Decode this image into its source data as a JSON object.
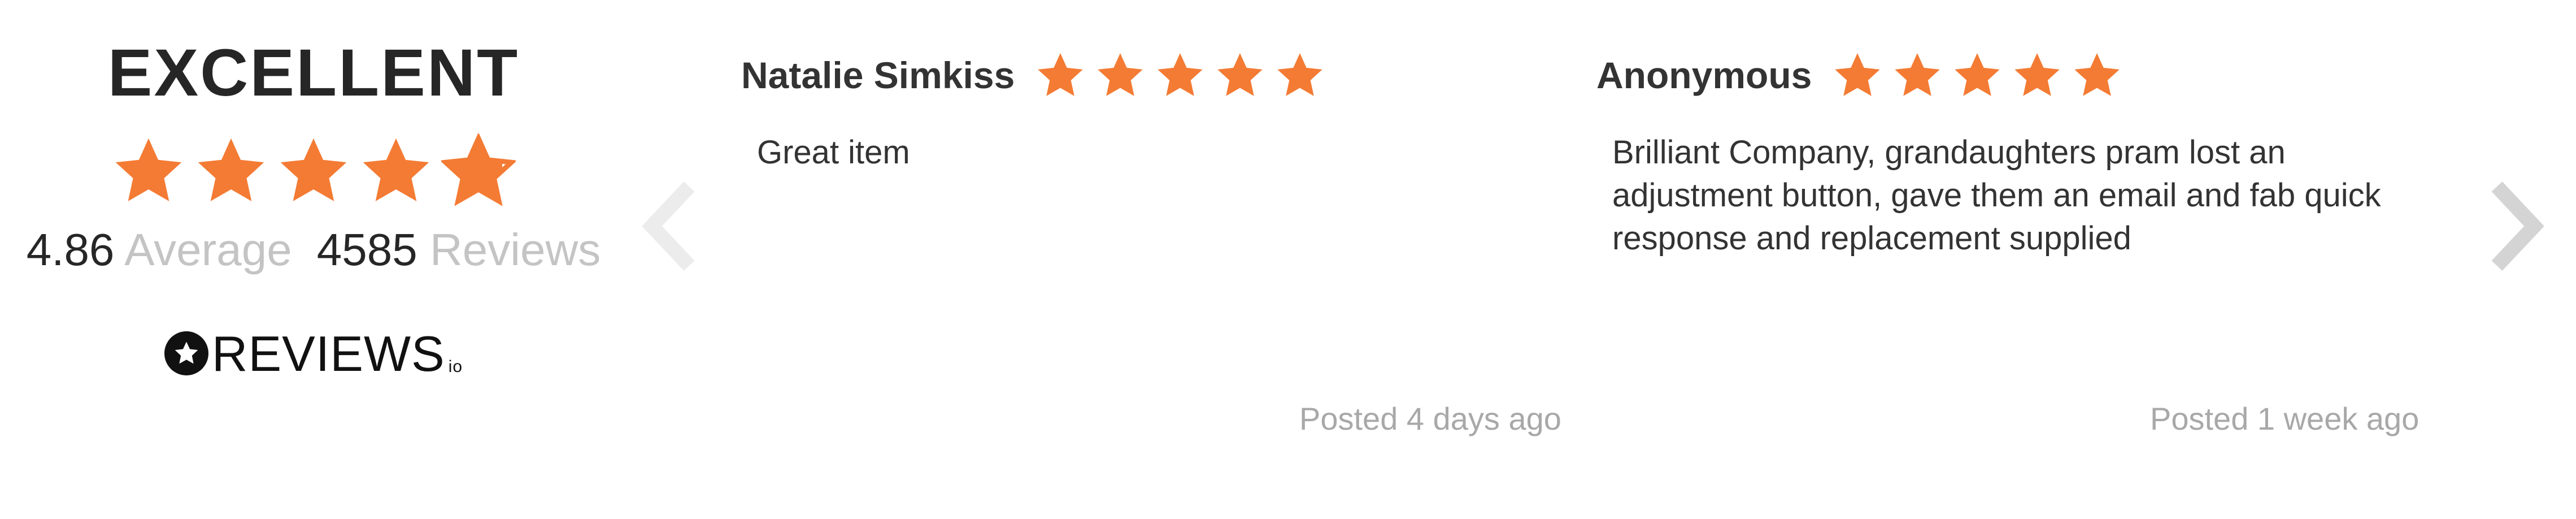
{
  "summary": {
    "rating_word": "EXCELLENT",
    "stars": 4.86,
    "average_value": "4.86",
    "average_label": "Average",
    "review_count": "4585",
    "reviews_label": "Reviews"
  },
  "logo": {
    "icon": "star-badge-icon",
    "text": "REVIEWS",
    "suffix": "io"
  },
  "navigation": {
    "prev_icon": "chevron-left-icon",
    "next_icon": "chevron-right-icon"
  },
  "reviews": [
    {
      "name": "Natalie Simkiss",
      "stars": 5,
      "text": "Great item",
      "posted": "Posted 4 days ago"
    },
    {
      "name": "Anonymous",
      "stars": 5,
      "text": "Brilliant Company, grandaughters pram lost an adjustment button, gave them an email and fab quick response and replacement supplied",
      "posted": "Posted 1 week ago"
    }
  ],
  "colors": {
    "star": "#f47b34",
    "star_empty": "#ffffff",
    "text_dark": "#262626",
    "text_muted": "#c4c4c4",
    "date": "#a8a8a8",
    "arrow_prev": "#ececec",
    "arrow_next": "#d4d4d4"
  }
}
